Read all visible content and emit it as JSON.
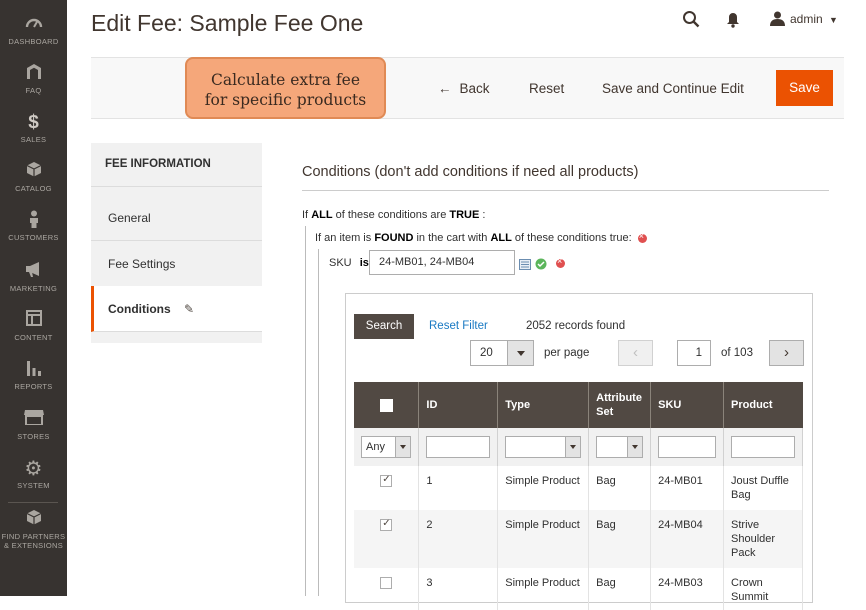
{
  "sidebar": {
    "items": [
      {
        "label": "DASHBOARD",
        "icon": "dashboard-icon"
      },
      {
        "label": "FAQ",
        "icon": "magento-logo-icon"
      },
      {
        "label": "SALES",
        "icon": "dollar-icon"
      },
      {
        "label": "CATALOG",
        "icon": "box-icon"
      },
      {
        "label": "CUSTOMERS",
        "icon": "person-icon"
      },
      {
        "label": "MARKETING",
        "icon": "megaphone-icon"
      },
      {
        "label": "CONTENT",
        "icon": "layout-icon"
      },
      {
        "label": "REPORTS",
        "icon": "bar-chart-icon"
      },
      {
        "label": "STORES",
        "icon": "store-icon"
      },
      {
        "label": "SYSTEM",
        "icon": "gear-icon"
      },
      {
        "label": "FIND PARTNERS & EXTENSIONS",
        "icon": "cube-icon"
      }
    ]
  },
  "header": {
    "title": "Edit Fee: Sample Fee One",
    "admin_user": "admin"
  },
  "callout": {
    "line1": "Calculate extra fee",
    "line2": "for specific products"
  },
  "actions": {
    "back": "Back",
    "reset": "Reset",
    "save_continue": "Save and Continue Edit",
    "save": "Save"
  },
  "tabs": {
    "heading": "FEE INFORMATION",
    "items": [
      "General",
      "Fee Settings",
      "Conditions"
    ]
  },
  "conditions": {
    "title": "Conditions (don't add conditions if need all products)",
    "line1": {
      "p1": "If",
      "v1": "ALL",
      "p2": "of these conditions are",
      "v2": "TRUE",
      "p3": ":"
    },
    "line2": {
      "p1": "If an item is",
      "v1": "FOUND",
      "p2": "in the cart with",
      "v2": "ALL",
      "p3": "of these conditions true:"
    },
    "sku": {
      "label": "SKU",
      "operator": "is",
      "value": "24-MB01, 24-MB04"
    }
  },
  "grid": {
    "search_label": "Search",
    "reset_filter_label": "Reset Filter",
    "records_found": "2052 records found",
    "per_page_value": "20",
    "per_page_label": "per page",
    "page_current": "1",
    "page_of": "of 103",
    "columns": [
      "ID",
      "Type",
      "Attribute Set",
      "SKU",
      "Product"
    ],
    "filter_any": "Any",
    "rows": [
      {
        "checked": true,
        "id": "1",
        "type": "Simple Product",
        "set": "Bag",
        "sku": "24-MB01",
        "product": "Joust Duffle Bag"
      },
      {
        "checked": true,
        "id": "2",
        "type": "Simple Product",
        "set": "Bag",
        "sku": "24-MB04",
        "product": "Strive Shoulder Pack"
      },
      {
        "checked": false,
        "id": "3",
        "type": "Simple Product",
        "set": "Bag",
        "sku": "24-MB03",
        "product": "Crown Summit"
      }
    ]
  },
  "colors": {
    "sidebar_bg": "#373330",
    "accent": "#eb5202",
    "grid_header": "#514943",
    "link": "#1979c3",
    "callout_bg": "#f5a77a"
  }
}
